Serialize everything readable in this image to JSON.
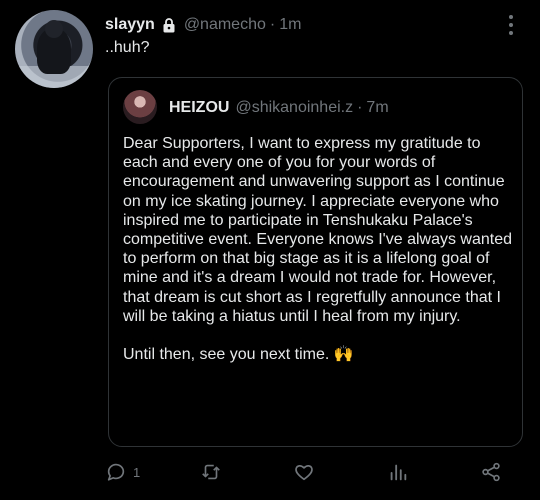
{
  "tweet": {
    "author_name": "slayyn",
    "author_handle": "@namecho",
    "separator": "·",
    "time": "1m",
    "text": "..huh?",
    "icons": {
      "avatar": "avatar-photo",
      "protected": "lock-icon",
      "more": "more-options-icon"
    }
  },
  "quote": {
    "author_name": "HEIZOU",
    "author_handle": "@shikanoinhei.z",
    "separator": "·",
    "time": "7m",
    "paragraph_1": "Dear Supporters, I want to express my gratitude to each and every one of you for your words of encouragement and unwavering support as I continue on my ice skating journey. I appreciate everyone who inspired me to participate in Tenshukaku Palace's competitive event. Everyone knows I've always wanted to perform on that big stage as it is a lifelong goal of mine and it's a dream I would not trade for. However, that dream is cut short as I regretfully announce that I will be taking a hiatus until I heal from my injury.",
    "paragraph_2": "Until then, see you next time. 🙌"
  },
  "actions": {
    "reply_count": "1",
    "icons": [
      "reply-icon",
      "retweet-icon",
      "like-icon",
      "views-icon",
      "share-icon"
    ]
  },
  "colors": {
    "background": "#000000",
    "primary_text": "#e7e9ea",
    "secondary_text": "#71767b",
    "border": "#2f3336"
  }
}
